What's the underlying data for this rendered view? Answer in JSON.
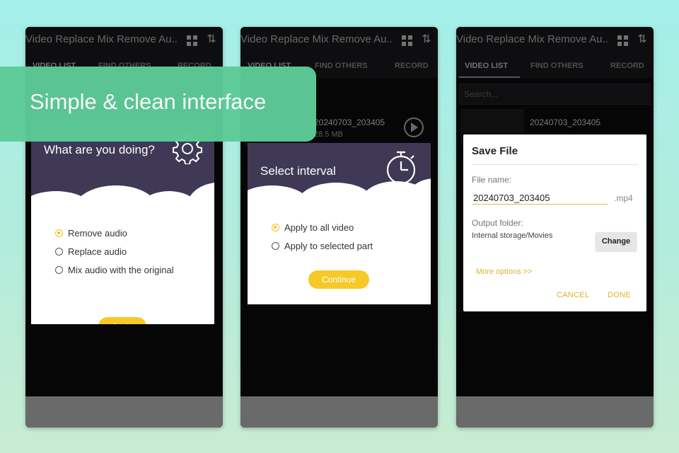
{
  "app_title": "Video Replace Mix Remove Au...",
  "tabs": [
    "VIDEO LIST",
    "FIND OTHERS",
    "RECORD"
  ],
  "search_placeholder": "Search...",
  "video": {
    "name": "20240703_203405",
    "size": "28.5 MB"
  },
  "banner": "Simple & clean interface",
  "dialog_action": {
    "title": "What are you doing?",
    "options": [
      "Remove audio",
      "Replace audio",
      "Mix audio with the original"
    ],
    "selected": 0,
    "button": "Apply"
  },
  "dialog_interval": {
    "title": "Select interval",
    "options": [
      "Apply to all video",
      "Apply to selected part"
    ],
    "selected": 0,
    "button": "Continue"
  },
  "dialog_save": {
    "title": "Save File",
    "file_name_label": "File name:",
    "file_name": "20240703_203405",
    "extension": ".mp4",
    "output_folder_label": "Output folder:",
    "output_folder": "Internal storage/Movies",
    "change_button": "Change",
    "more_options": "More options >>",
    "cancel": "CANCEL",
    "done": "DONE"
  },
  "colors": {
    "accent": "#f7c928",
    "header": "#3f3956",
    "banner": "#5dcb98"
  }
}
